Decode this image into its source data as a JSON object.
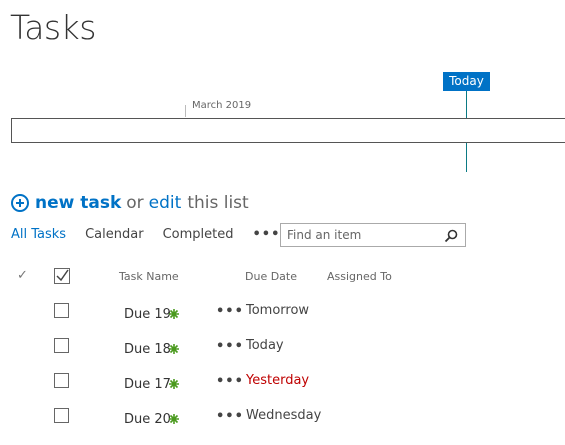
{
  "page": {
    "title": "Tasks"
  },
  "timeline": {
    "today_label": "Today",
    "month_label": "March 2019"
  },
  "actions": {
    "new_task": "new task",
    "or": "or",
    "edit": "edit",
    "this_list": "this list"
  },
  "views": {
    "tabs": [
      "All Tasks",
      "Calendar",
      "Completed"
    ],
    "active": "All Tasks",
    "more": "•••"
  },
  "search": {
    "placeholder": "Find an item"
  },
  "columns": {
    "check": "✓",
    "task_name": "Task Name",
    "due_date": "Due Date",
    "assigned_to": "Assigned To"
  },
  "tasks": [
    {
      "name": "Due 19",
      "due": "Tomorrow",
      "dots": "•••"
    },
    {
      "name": "Due 18",
      "due": "Today",
      "dots": "•••"
    },
    {
      "name": "Due 17",
      "due": "Yesterday",
      "dots": "•••"
    },
    {
      "name": "Due 20",
      "due": "Wednesday",
      "dots": "•••"
    }
  ],
  "colors": {
    "accent": "#0072c6",
    "overdue": "#bf0000",
    "new_marker": "#4a9a1e",
    "today_line": "#0b7a84"
  },
  "icons": {
    "add": "plus-circle-icon",
    "search": "search-icon",
    "new": "new-item-icon",
    "select_all": "select-all-checkbox-icon"
  }
}
